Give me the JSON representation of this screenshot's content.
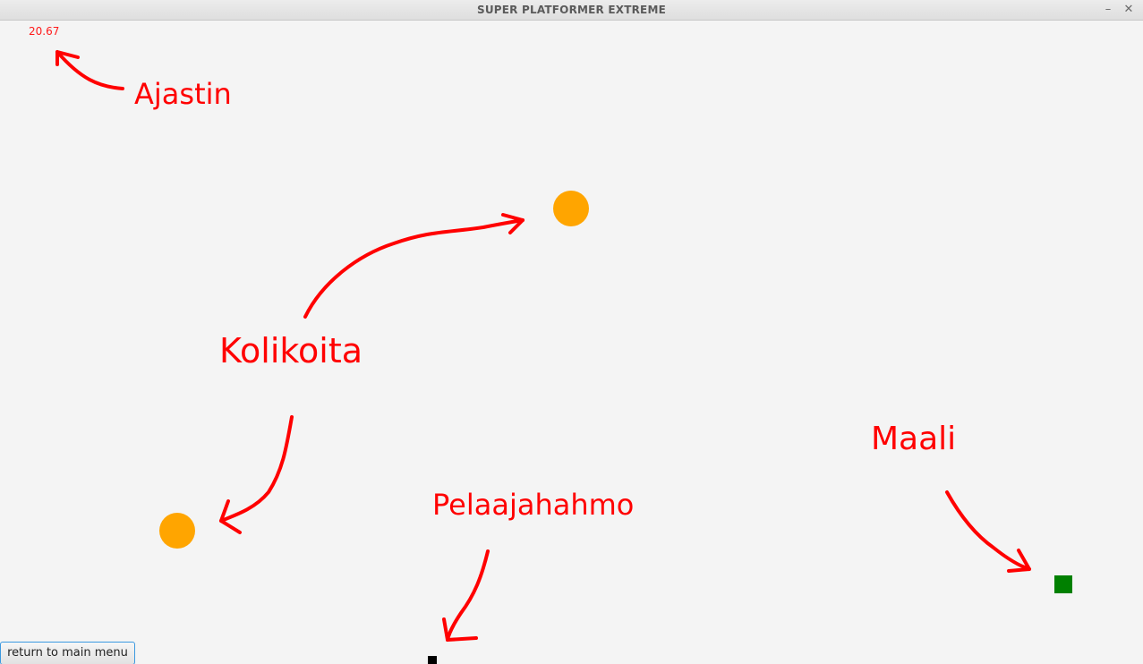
{
  "window": {
    "title": "SUPER PLATFORMER EXTREME",
    "minimize_glyph": "–",
    "close_glyph": "✕"
  },
  "hud": {
    "timer": "20.67",
    "return_button_label": "return to main menu"
  },
  "annotations": {
    "timer_label": "Ajastin",
    "coins_label": "Kolikoita",
    "goal_label": "Maali",
    "player_label": "Pelaajahahmo",
    "color": "#ff0000"
  },
  "game_objects": {
    "coin_color": "#ffa500",
    "goal_color": "#008000",
    "player_color": "#000000",
    "coin_count": 2
  }
}
